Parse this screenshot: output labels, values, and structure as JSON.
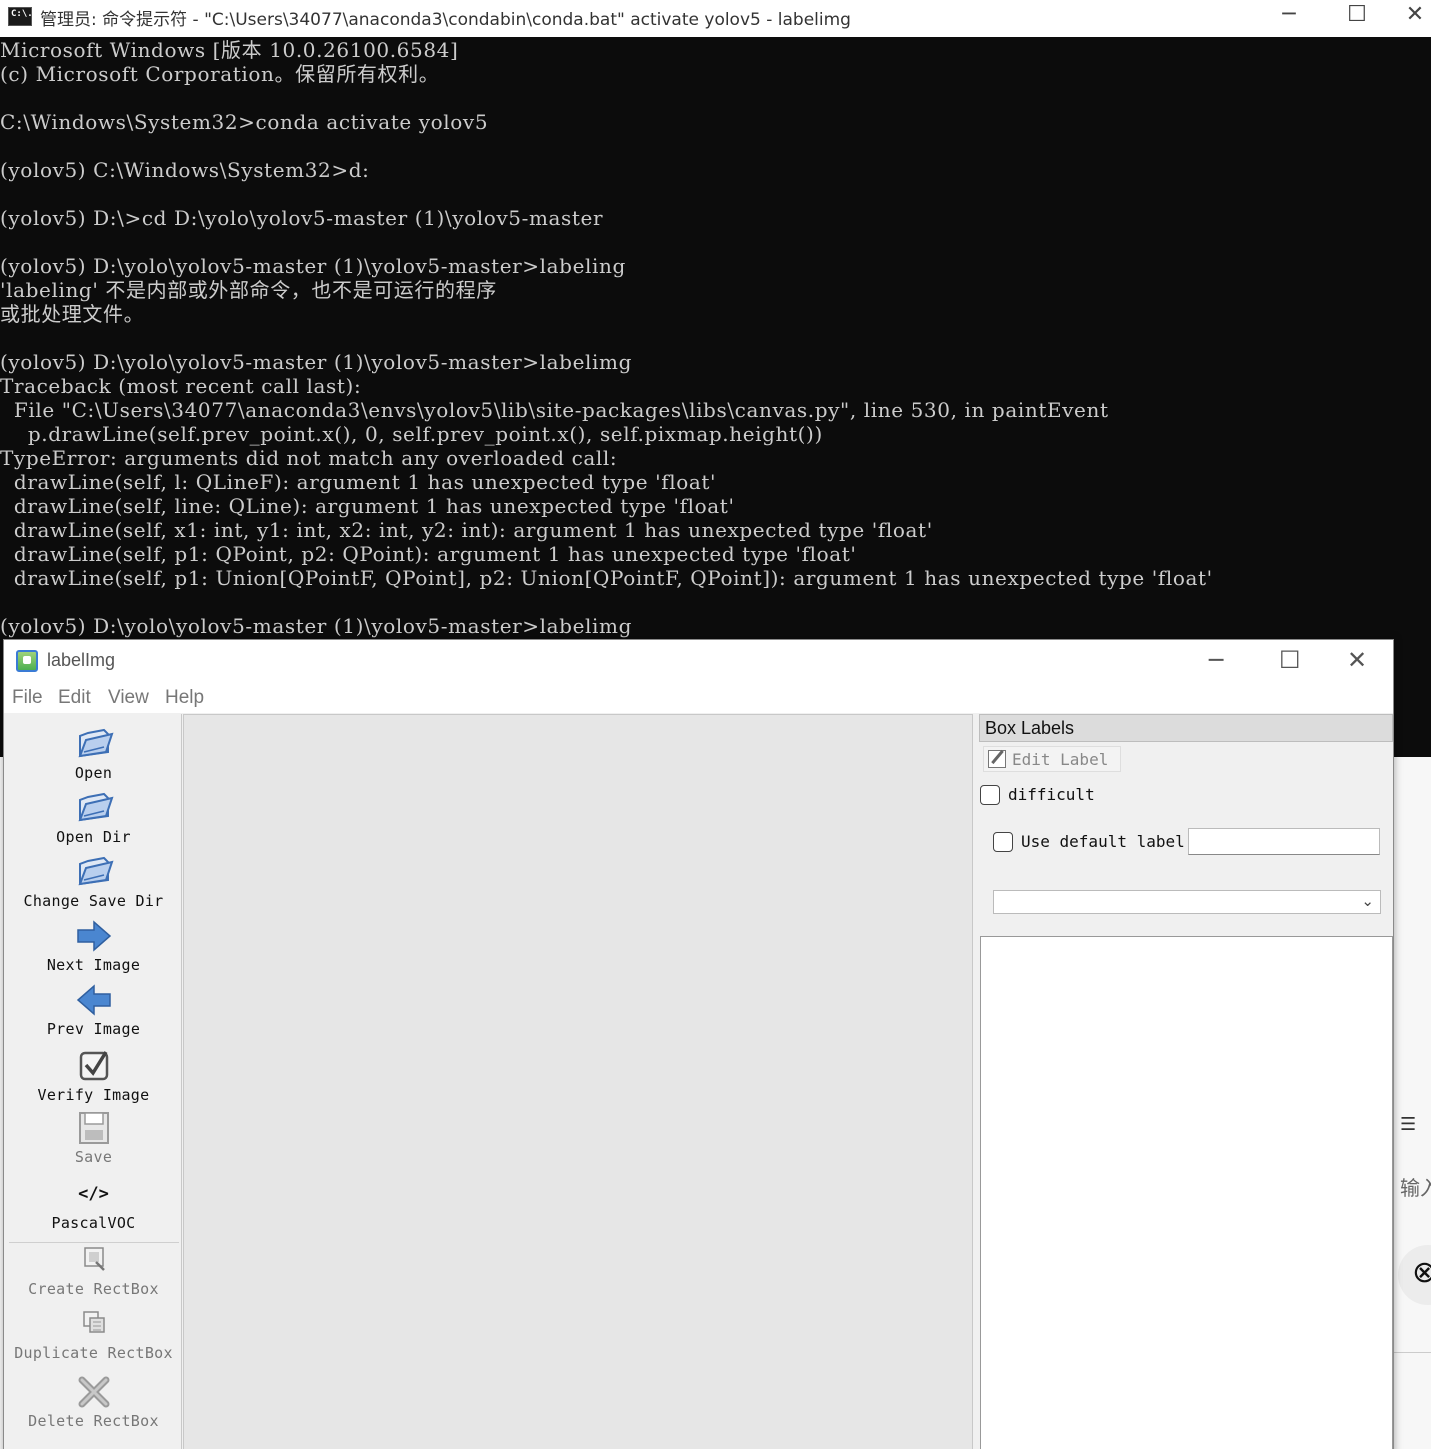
{
  "cmd": {
    "title": "管理员: 命令提示符 - \"C:\\Users\\34077\\anaconda3\\condabin\\conda.bat\"  activate yolov5 - labelimg",
    "icon_text": "C:\\.",
    "controls": {
      "minimize": "─",
      "maximize": "☐",
      "close": "✕"
    },
    "lines": [
      "Microsoft Windows [版本 10.0.26100.6584]",
      "(c) Microsoft Corporation。保留所有权利。",
      "",
      "C:\\Windows\\System32>conda activate yolov5",
      "",
      "(yolov5) C:\\Windows\\System32>d:",
      "",
      "(yolov5) D:\\>cd D:\\yolo\\yolov5-master (1)\\yolov5-master",
      "",
      "(yolov5) D:\\yolo\\yolov5-master (1)\\yolov5-master>labeling",
      "'labeling' 不是内部或外部命令，也不是可运行的程序",
      "或批处理文件。",
      "",
      "(yolov5) D:\\yolo\\yolov5-master (1)\\yolov5-master>labelimg",
      "Traceback (most recent call last):",
      "  File \"C:\\Users\\34077\\anaconda3\\envs\\yolov5\\lib\\site-packages\\libs\\canvas.py\", line 530, in paintEvent",
      "    p.drawLine(self.prev_point.x(), 0, self.prev_point.x(), self.pixmap.height())",
      "TypeError: arguments did not match any overloaded call:",
      "  drawLine(self, l: QLineF): argument 1 has unexpected type 'float'",
      "  drawLine(self, line: QLine): argument 1 has unexpected type 'float'",
      "  drawLine(self, x1: int, y1: int, x2: int, y2: int): argument 1 has unexpected type 'float'",
      "  drawLine(self, p1: QPoint, p2: QPoint): argument 1 has unexpected type 'float'",
      "  drawLine(self, p1: Union[QPointF, QPoint], p2: Union[QPointF, QPoint]): argument 1 has unexpected type 'float'",
      "",
      "(yolov5) D:\\yolo\\yolov5-master (1)\\yolov5-master>labelimg"
    ]
  },
  "labelimg": {
    "title": "labelImg",
    "controls": {
      "minimize": "─",
      "maximize": "☐",
      "close": "✕"
    },
    "menu": [
      "File",
      "Edit",
      "View",
      "Help"
    ],
    "toolbar": [
      {
        "label": "Open",
        "icon": "folder-open-icon"
      },
      {
        "label": "Open Dir",
        "icon": "folder-open-icon"
      },
      {
        "label": "Change Save Dir",
        "icon": "folder-open-icon"
      },
      {
        "label": "Next Image",
        "icon": "arrow-right-icon"
      },
      {
        "label": "Prev Image",
        "icon": "arrow-left-icon"
      },
      {
        "label": "Verify Image",
        "icon": "checkbox-check-icon"
      },
      {
        "label": "Save",
        "icon": "floppy-disk-icon"
      },
      {
        "label": "PascalVOC",
        "icon": "code-brackets-icon",
        "icon_text": "</>"
      },
      {
        "label": "Create RectBox",
        "icon": "create-rectbox-icon"
      },
      {
        "label": "Duplicate RectBox",
        "icon": "duplicate-rectbox-icon"
      },
      {
        "label": "Delete RectBox",
        "icon": "delete-x-icon"
      }
    ],
    "box_labels": {
      "title": "Box Labels",
      "edit_label": "Edit Label",
      "difficult": "difficult",
      "use_default_label": "Use default label",
      "default_label_value": "",
      "combo_value": "",
      "combo_arrow": "⌄"
    },
    "colors": {
      "accent": "#3b76c4",
      "canvas": "#e6e6e6",
      "cmd_bg": "#0c0c0c",
      "cmd_fg": "#cccccc"
    }
  },
  "background_app": {
    "list_icon": "☰",
    "input_hint": "输入",
    "round_glyph": "⊗"
  }
}
